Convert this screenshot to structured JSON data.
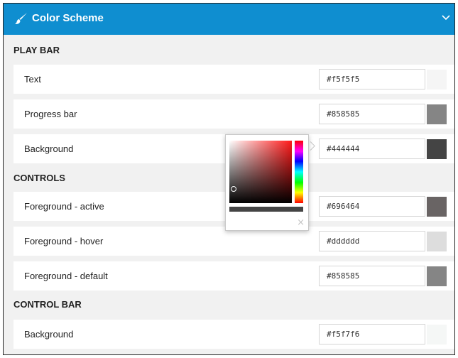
{
  "header": {
    "title": "Color Scheme",
    "icon": "paint-brush-icon",
    "collapse_icon": "chevron-down-icon",
    "background": "#0f8ed0"
  },
  "sections": [
    {
      "title": "PLAY BAR",
      "rows": [
        {
          "label": "Text",
          "value": "#f5f5f5",
          "color": "#f5f5f5"
        },
        {
          "label": "Progress bar",
          "value": "#858585",
          "color": "#858585"
        },
        {
          "label": "Background",
          "value": "#444444",
          "color": "#444444"
        }
      ]
    },
    {
      "title": "CONTROLS",
      "rows": [
        {
          "label": "Foreground - active",
          "value": "#696464",
          "color": "#696464"
        },
        {
          "label": "Foreground - hover",
          "value": "#dddddd",
          "color": "#dddddd"
        },
        {
          "label": "Foreground - default",
          "value": "#858585",
          "color": "#858585"
        }
      ]
    },
    {
      "title": "CONTROL BAR",
      "rows": [
        {
          "label": "Background",
          "value": "#f5f7f6",
          "color": "#f5f7f6"
        }
      ]
    }
  ],
  "color_picker": {
    "open_for": "PLAY BAR / Background",
    "preview_color": "#444444",
    "hue": "red",
    "close_symbol": "×"
  }
}
